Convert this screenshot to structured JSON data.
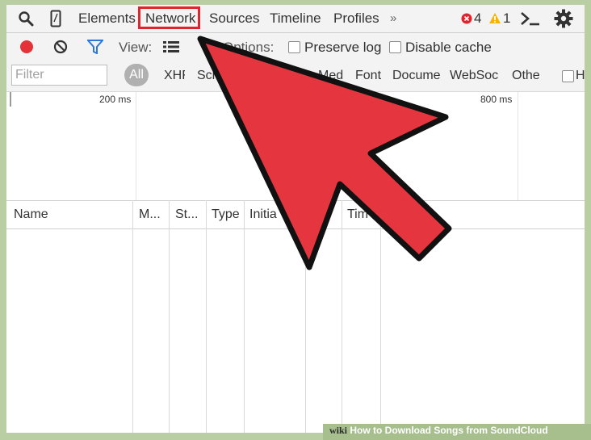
{
  "tabs": {
    "items": [
      "Elements",
      "Network",
      "Sources",
      "Timeline",
      "Profiles"
    ],
    "more": "»",
    "error_count": "4",
    "warning_count": "1"
  },
  "toolbar": {
    "view_label": "View:",
    "options_label": "Options:",
    "preserve_log": "Preserve log",
    "disable_cache": "Disable cache"
  },
  "filter": {
    "placeholder": "Filter",
    "all_label": "All",
    "types": [
      "XHF",
      "Scr",
      "Med",
      "Font",
      "Docume",
      "WebSoc",
      "Othe"
    ],
    "hide_label": "H"
  },
  "overview": {
    "ticks": [
      "200 ms",
      "800 ms"
    ]
  },
  "table": {
    "columns": [
      "Name",
      "M...",
      "St...",
      "Type",
      "Initia",
      "Tim"
    ]
  },
  "colors": {
    "arrow": "#e53640",
    "highlight": "#e2232b",
    "record": "#e53238",
    "filter_icon": "#2b78d6"
  },
  "watermark": {
    "prefix": "wiki",
    "text": "How to Download Songs from SoundCloud"
  }
}
